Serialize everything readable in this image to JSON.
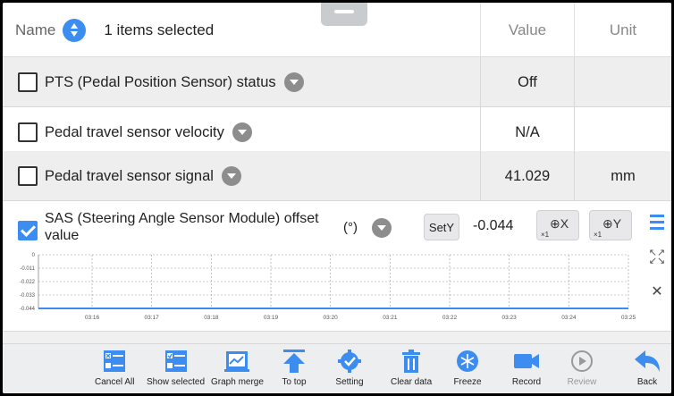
{
  "header": {
    "name_label": "Name",
    "selected_text": "1 items selected",
    "value_label": "Value",
    "unit_label": "Unit"
  },
  "rows": [
    {
      "name": "PTS (Pedal Position Sensor) status",
      "value": "Off",
      "unit": ""
    },
    {
      "name": "Pedal travel sensor velocity",
      "value": "N/A",
      "unit": ""
    },
    {
      "name": "Pedal travel sensor signal",
      "value": "41.029",
      "unit": "mm"
    }
  ],
  "graph_row": {
    "name": "SAS (Steering Angle Sensor Module) offset value",
    "unit": "(°)",
    "sety_label": "SetY",
    "value": "-0.044",
    "zoom_x_label": "⊕X",
    "zoom_x_scale": "×1",
    "zoom_y_label": "⊕Y",
    "zoom_y_scale": "×1"
  },
  "chart_data": {
    "type": "line",
    "y_ticks": [
      "0",
      "-0.011",
      "-0.022",
      "-0.033",
      "-0.044"
    ],
    "x_ticks": [
      "03:16",
      "03:17",
      "03:18",
      "03:19",
      "03:20",
      "03:21",
      "03:22",
      "03:23",
      "03:24",
      "03:25"
    ],
    "ylim": [
      -0.044,
      0
    ],
    "series": [
      {
        "values": [
          -0.044,
          -0.044,
          -0.044,
          -0.044,
          -0.044,
          -0.044,
          -0.044,
          -0.044,
          -0.044,
          -0.044
        ]
      }
    ],
    "grid": true,
    "line_color": "#3d8cf0"
  },
  "toolbar": [
    {
      "label": "Cancel All",
      "icon": "cancel-all-icon"
    },
    {
      "label": "Show selected",
      "icon": "show-selected-icon"
    },
    {
      "label": "Graph merge",
      "icon": "graph-merge-icon"
    },
    {
      "label": "To top",
      "icon": "to-top-icon"
    },
    {
      "label": "Setting",
      "icon": "setting-icon"
    },
    {
      "label": "Clear data",
      "icon": "clear-data-icon"
    },
    {
      "label": "Freeze",
      "icon": "freeze-icon"
    },
    {
      "label": "Record",
      "icon": "record-icon"
    },
    {
      "label": "Review",
      "icon": "review-icon"
    },
    {
      "label": "Back",
      "icon": "back-icon"
    }
  ],
  "colors": {
    "accent": "#3d8cf0",
    "row_grey": "#eeeeee",
    "toolbar_bg": "#eceef0"
  }
}
